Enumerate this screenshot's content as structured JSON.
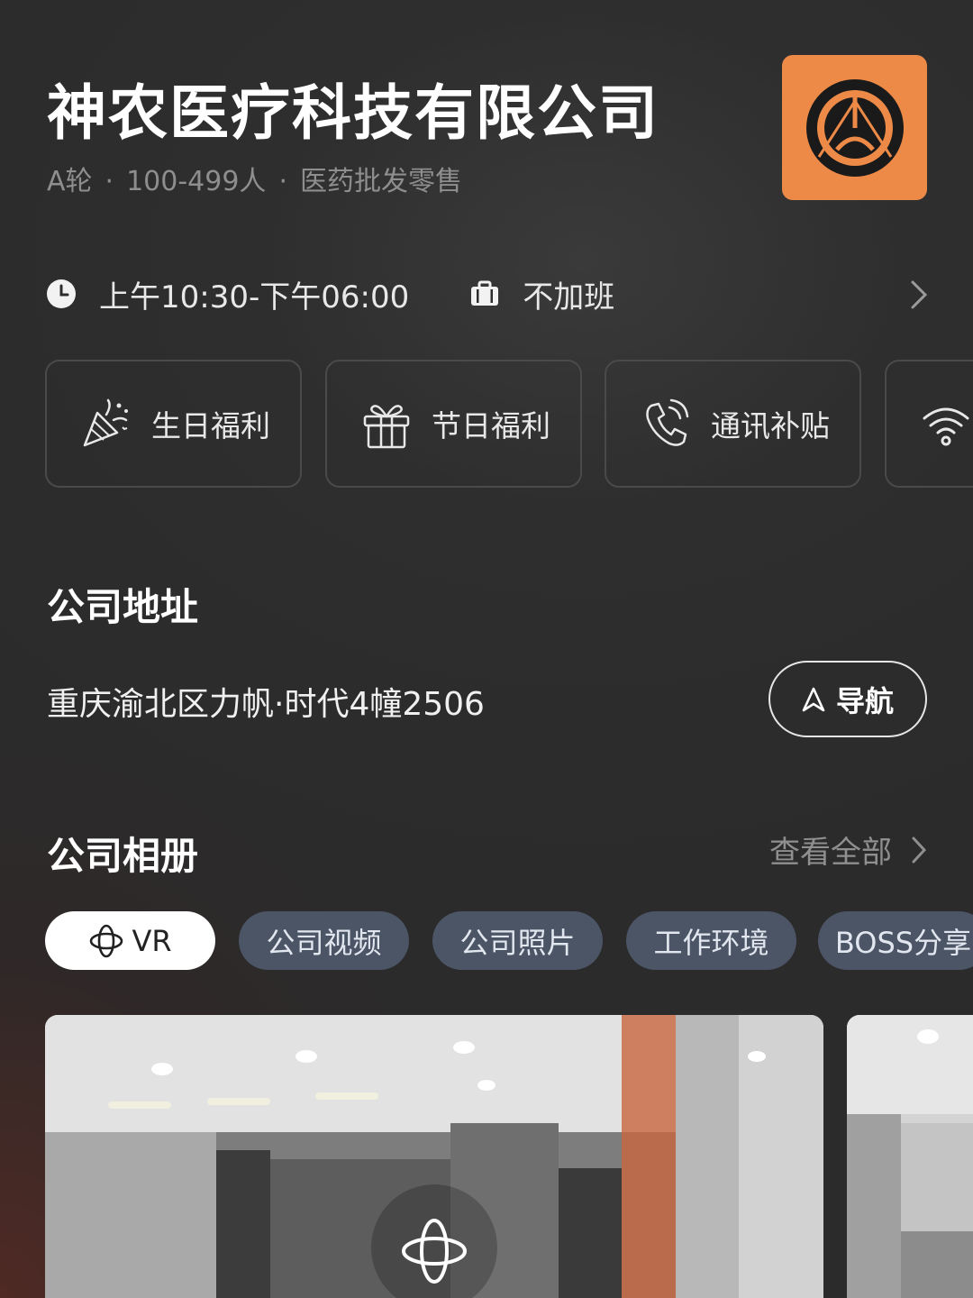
{
  "company": {
    "name": "神农医疗科技有限公司",
    "meta": [
      "A轮",
      "100-499人",
      "医药批发零售"
    ],
    "meta_separator": "·",
    "logo_color": "#ed8a47"
  },
  "work": {
    "hours": "上午10:30-下午06:00",
    "overtime": "不加班"
  },
  "benefits": [
    {
      "label": "生日福利",
      "icon": "party-popper-icon"
    },
    {
      "label": "节日福利",
      "icon": "gift-icon"
    },
    {
      "label": "通讯补贴",
      "icon": "phone-icon"
    },
    {
      "label": "",
      "icon": "wifi-icon"
    }
  ],
  "address": {
    "title": "公司地址",
    "text": "重庆渝北区力帆·时代4幢2506",
    "nav_label": "导航"
  },
  "album": {
    "title": "公司相册",
    "view_all": "查看全部",
    "tabs": [
      "VR",
      "公司视频",
      "公司照片",
      "工作环境",
      "BOSS分享"
    ]
  }
}
